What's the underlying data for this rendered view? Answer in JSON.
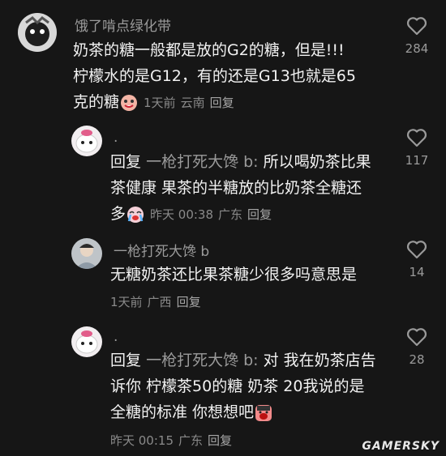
{
  "comments": [
    {
      "username": "饿了啃点绿化带",
      "lines": [
        "奶茶的糖一般都是放的G2的糖，但是!!!",
        "柠檬水的是G12，有的还是G13也就是65",
        "克的糖"
      ],
      "emoji": "crying-laugh-emoji",
      "time": "1天前",
      "location": "云南",
      "reply_label": "回复",
      "likes": "284"
    },
    {
      "username": ".",
      "reply_prefix": "回复",
      "reply_target": "一枪打死大馋 b:",
      "lines": [
        "所以喝奶茶比果",
        "茶健康 果茶的半糖放的比奶茶全糖还",
        "多"
      ],
      "emoji": "crying-emoji",
      "time": "昨天 00:38",
      "location": "广东",
      "reply_label": "回复",
      "likes": "117"
    },
    {
      "username": "一枪打死大馋 b",
      "lines": [
        "无糖奶茶还比果茶糖少很多吗意思是"
      ],
      "time": "1天前",
      "location": "广西",
      "reply_label": "回复",
      "likes": "14"
    },
    {
      "username": ".",
      "reply_prefix": "回复",
      "reply_target": "一枪打死大馋 b:",
      "lines": [
        "对 我在奶茶店告",
        "诉你 柠檬茶50的糖 奶茶 20我说的是",
        "全糖的标准 你想想吧"
      ],
      "emoji": "shouting-emoji",
      "time": "昨天 00:15",
      "location": "广东",
      "reply_label": "回复",
      "likes": "28"
    }
  ],
  "watermark": "GAMERSKY",
  "colors": {
    "background": "#161616",
    "text": "#f2f2f2",
    "muted": "#9a9a9a"
  }
}
